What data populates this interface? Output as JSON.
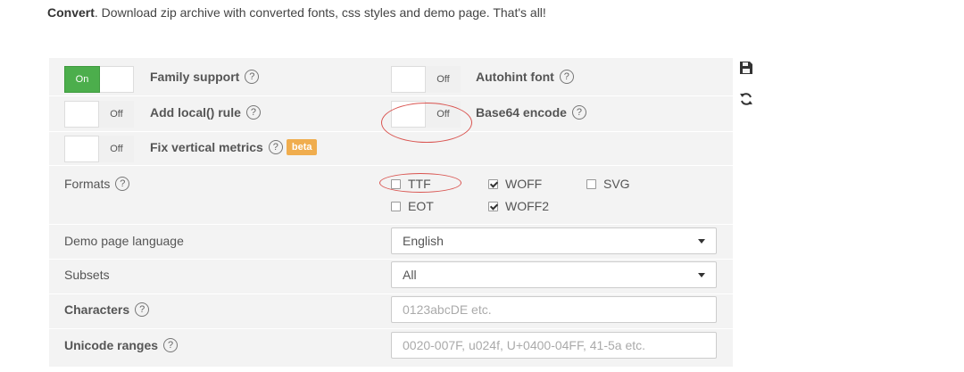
{
  "intro": {
    "bold": "Convert",
    "text": ". Download zip archive with converted fonts, css styles and demo page. That's all!"
  },
  "options": {
    "family_support": {
      "label": "Family support",
      "state": "On"
    },
    "autohint_font": {
      "label": "Autohint font",
      "state": "Off"
    },
    "add_local_rule": {
      "label": "Add local() rule",
      "state": "Off"
    },
    "base64_encode": {
      "label": "Base64 encode",
      "state": "Off"
    },
    "fix_vertical_metrics": {
      "label": "Fix vertical metrics",
      "state": "Off",
      "badge": "beta"
    }
  },
  "help_glyph": "?",
  "formats": {
    "label": "Formats",
    "items": [
      {
        "label": "TTF",
        "checked": false
      },
      {
        "label": "WOFF",
        "checked": true
      },
      {
        "label": "SVG",
        "checked": false
      },
      {
        "label": "EOT",
        "checked": false
      },
      {
        "label": "WOFF2",
        "checked": true
      }
    ]
  },
  "demo_language": {
    "label": "Demo page language",
    "value": "English"
  },
  "subsets": {
    "label": "Subsets",
    "value": "All"
  },
  "characters": {
    "label": "Characters",
    "placeholder": "0123abcDE etc."
  },
  "unicode_ranges": {
    "label": "Unicode ranges",
    "placeholder": "0020-007F, u024f, U+0400-04FF, 41-5a etc."
  },
  "side_icons": [
    "save-icon",
    "refresh-icon"
  ],
  "colors": {
    "on": "#4cae4c",
    "beta": "#f0ad4e",
    "annotation": "#d9534f",
    "panel": "#f3f3f3"
  }
}
